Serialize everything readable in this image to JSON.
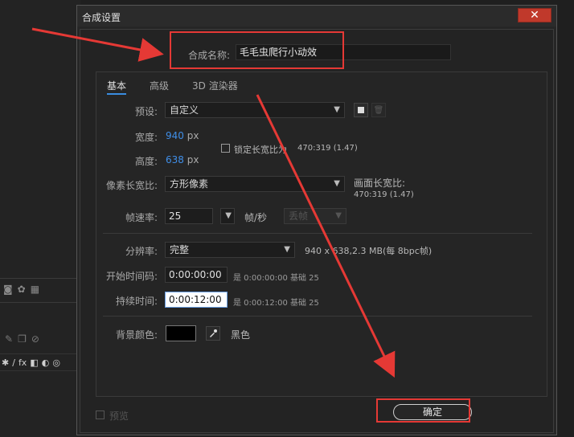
{
  "dialog": {
    "title": "合成设置",
    "close": "✕"
  },
  "composition_name": {
    "label": "合成名称:",
    "value": "毛毛虫爬行小动效"
  },
  "tabs": [
    {
      "label": "基本",
      "active": true
    },
    {
      "label": "高级",
      "active": false
    },
    {
      "label": "3D 渲染器",
      "active": false
    }
  ],
  "basic": {
    "preset_label": "预设:",
    "preset_value": "自定义",
    "width_label": "宽度:",
    "width_value": "940",
    "height_label": "高度:",
    "height_value": "638",
    "px_unit": "px",
    "lock_aspect_label": "锁定长宽比为",
    "lock_aspect_value": "470:319 (1.47)",
    "pixel_aspect_label": "像素长宽比:",
    "pixel_aspect_value": "方形像素",
    "frame_aspect_label": "画面长宽比:",
    "frame_aspect_value": "470:319 (1.47)",
    "frame_rate_label": "帧速率:",
    "frame_rate_value": "25",
    "frame_rate_unit": "帧/秒",
    "drop_frame_value": "丢帧",
    "resolution_label": "分辨率:",
    "resolution_value": "完整",
    "resolution_info": "940 x 638,2.3 MB(每 8bpc帧)",
    "start_timecode_label": "开始时间码:",
    "start_timecode_value": "0:00:00:00",
    "start_timecode_info": "是 0:00:00:00  基础 25",
    "duration_label": "持续时间:",
    "duration_value": "0:00:12:00",
    "duration_info": "是 0:00:12:00  基础 25",
    "bg_color_label": "背景颜色:",
    "bg_color_name": "黑色"
  },
  "footer": {
    "preview_label": "预览",
    "ok_label": "确定"
  },
  "colors": {
    "accent": "#3a8de0",
    "annotation_red": "#e53935"
  },
  "background_toolbar": {
    "fx_label": "fx"
  }
}
